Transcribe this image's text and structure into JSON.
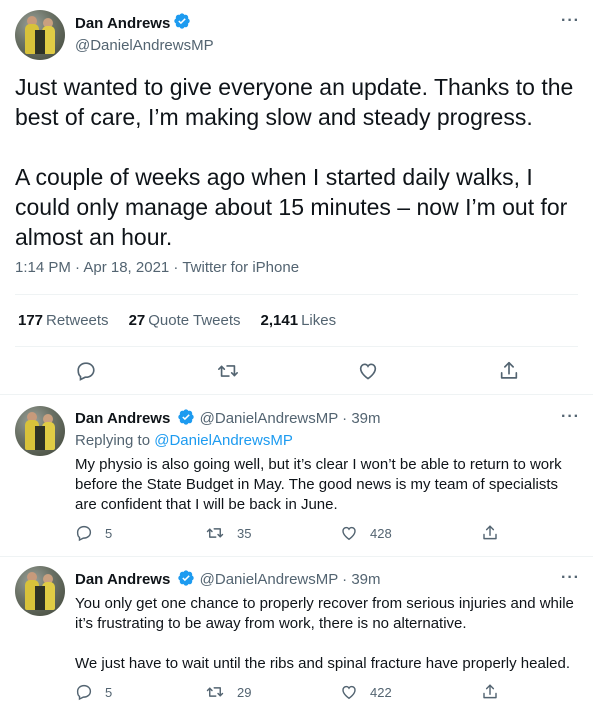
{
  "main": {
    "author_name": "Dan Andrews",
    "author_handle": "@DanielAndrewsMP",
    "text": [
      "Just wanted to give everyone an update. Thanks to the best of care, I’m making slow and steady progress.",
      "A couple of weeks ago when I started daily walks, I could only manage about 15 minutes – now I’m out for almost an hour."
    ],
    "timestamp": "1:14 PM · Apr 18, 2021 · Twitter for iPhone",
    "stats": {
      "retweets_count": "177",
      "retweets_label": "Retweets",
      "quotes_count": "27",
      "quotes_label": "Quote Tweets",
      "likes_count": "2,141",
      "likes_label": "Likes"
    },
    "more_label": "···"
  },
  "replies": [
    {
      "author_name": "Dan Andrews",
      "author_handle": "@DanielAndrewsMP",
      "time": "· 39m",
      "replying_prefix": "Replying to",
      "replying_handle": "@DanielAndrewsMP",
      "text": [
        "My physio is also going well, but it’s clear I won’t be able to return to work before the State Budget in May. The good news is my team of specialists are confident that I will be back in June."
      ],
      "reply_count": "5",
      "retweet_count": "35",
      "like_count": "428"
    },
    {
      "author_name": "Dan Andrews",
      "author_handle": "@DanielAndrewsMP",
      "time": "· 39m",
      "text": [
        "You only get one chance to properly recover from serious injuries and while it’s frustrating to be away from work, there is no alternative.",
        "We just have to wait until the ribs and spinal fracture have properly healed."
      ],
      "reply_count": "5",
      "retweet_count": "29",
      "like_count": "422"
    }
  ],
  "colors": {
    "accent": "#1d9bf0",
    "text": "#0f1419",
    "secondary": "#536471",
    "divider": "#eff3f4"
  }
}
